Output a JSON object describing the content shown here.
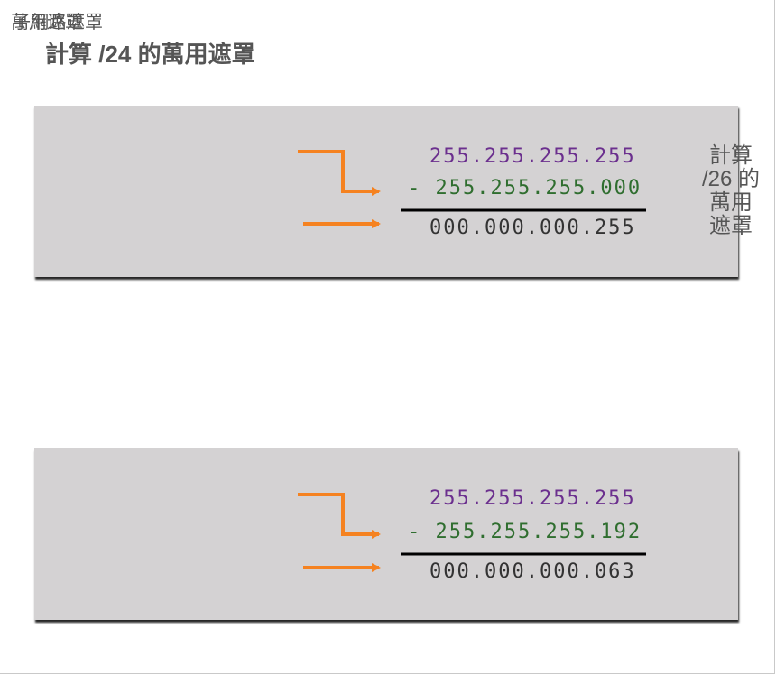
{
  "page": {
    "overlap_title_1": "萬用遮罩",
    "overlap_title_2": "子網路遮罩",
    "heading": "計算 /24 的萬用遮罩"
  },
  "side_label": {
    "line1": "計算",
    "line2": "/26 的",
    "line3": "萬用",
    "line4": "遮罩"
  },
  "calculations": [
    {
      "all_ones": "255.255.255.255",
      "subnet_mask": "- 255.255.255.000",
      "wildcard": "000.000.000.255"
    },
    {
      "all_ones": "255.255.255.255",
      "subnet_mask": "- 255.255.255.192",
      "wildcard": "000.000.000.063"
    }
  ],
  "colors": {
    "arrow": "#f58220",
    "all_ones": "#6b2f8e",
    "subnet_mask": "#2f6e2f",
    "wildcard": "#333333",
    "panel": "#d4d2d3"
  }
}
